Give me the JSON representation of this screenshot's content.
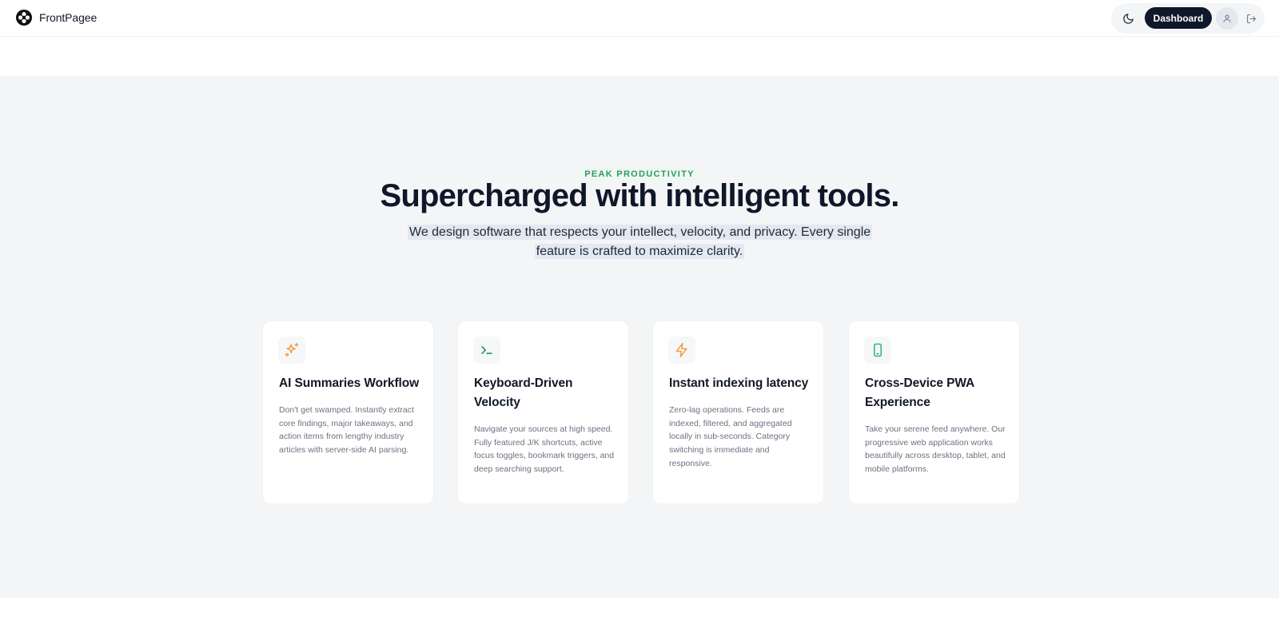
{
  "header": {
    "brand_name": "FrontPagee",
    "logo_icon": "frontpage-logo",
    "theme_icon": "moon-icon",
    "dashboard_label": "Dashboard",
    "avatar_icon": "user-icon",
    "logout_icon": "logout-icon"
  },
  "hero": {
    "eyebrow": "PEAK PRODUCTIVITY",
    "headline": "Supercharged with intelligent tools.",
    "subtitle": "We design software that respects your intellect, velocity, and privacy. Every single feature is crafted to maximize clarity."
  },
  "features": [
    {
      "icon": "sparkles-icon",
      "icon_color": "#f59e42",
      "title": "AI Summaries Workflow",
      "description": "Don't get swamped. Instantly extract core findings, major takeaways, and action items from lengthy industry articles with server-side AI parsing."
    },
    {
      "icon": "terminal-icon",
      "icon_color": "#1e8a5e",
      "title": "Keyboard-Driven Velocity",
      "description": "Navigate your sources at high speed. Fully featured J/K shortcuts, active focus toggles, bookmark triggers, and deep searching support."
    },
    {
      "icon": "lightning-icon",
      "icon_color": "#f59e42",
      "title": "Instant indexing latency",
      "description": "Zero-lag operations. Feeds are indexed, filtered, and aggregated locally in sub-seconds. Category switching is immediate and responsive."
    },
    {
      "icon": "mobile-device-icon",
      "icon_color": "#2fb37a",
      "title": "Cross-Device PWA Experience",
      "description": "Take your serene feed anywhere. Our progressive web application works beautifully across desktop, tablet, and mobile platforms."
    }
  ],
  "colors": {
    "accent_dark": "#0f172a",
    "eyebrow_green": "#2e9a63",
    "section_bg": "#f4f5f7"
  }
}
